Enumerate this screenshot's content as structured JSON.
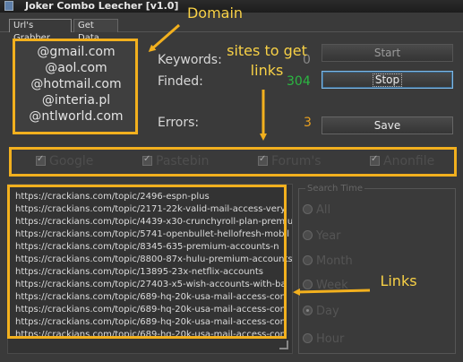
{
  "window": {
    "title": "Joker Combo Leecher [v1.0]"
  },
  "tabs": [
    {
      "label": "Url's Grabber"
    },
    {
      "label": "Get Data"
    }
  ],
  "domains": [
    "@gmail.com",
    "@aol.com",
    "@hotmail.com",
    "@interia.pl",
    "@ntlworld.com"
  ],
  "stats": {
    "keywords_label": "Keywords:",
    "keywords_value": "0",
    "finded_label": "Finded:",
    "finded_value": "304",
    "errors_label": "Errors:",
    "errors_value": "3"
  },
  "buttons": {
    "start": "Start",
    "stop": "Stop",
    "save": "Save"
  },
  "sites": [
    "Google",
    "Pastebin",
    "Forum's",
    "Anonfile"
  ],
  "links": [
    "https://crackians.com/topic/2496-espn-plus",
    "https://crackians.com/topic/2171-22k-valid-mail-access-very",
    "https://crackians.com/topic/4439-x30-crunchyroll-plan-premiu",
    "https://crackians.com/topic/5741-openbullet-hellofresh-mobil",
    "https://crackians.com/topic/8345-635-premium-accounts-n",
    "https://crackians.com/topic/8800-87x-hulu-premium-accounts",
    "https://crackians.com/topic/13895-23x-netflix-accounts",
    "https://crackians.com/topic/27403-x5-wish-accounts-with-ba",
    "https://crackians.com/topic/689-hq-20k-usa-mail-access-con",
    "https://crackians.com/topic/689-hq-20k-usa-mail-access-con",
    "https://crackians.com/topic/689-hq-20k-usa-mail-access-con",
    "https://crackians.com/topic/689-hq-20k-usa-mail-access-con"
  ],
  "search_time": {
    "title": "Search Time",
    "options": [
      "All",
      "Year",
      "Month",
      "Week",
      "Day",
      "Hour"
    ],
    "selected": "Day"
  },
  "annotations": {
    "domain": "Domain",
    "sites_line1": "sites to get",
    "sites_line2": "links",
    "links": "Links",
    "color": "#f2b01e"
  }
}
